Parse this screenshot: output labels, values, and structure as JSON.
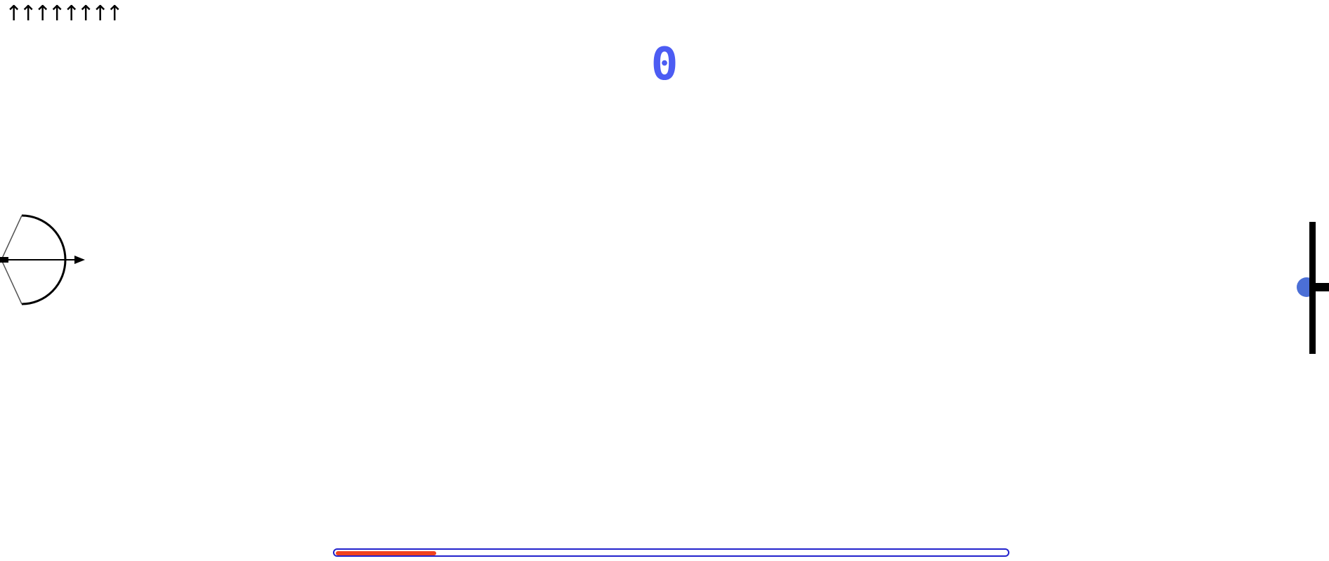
{
  "hud": {
    "arrows_remaining": 8,
    "arrow_glyph": "↑",
    "score": "0",
    "score_color": "#4c5cf3"
  },
  "power_meter": {
    "level": 0.15,
    "fill_color": "#f0421e",
    "border_color": "#2222cc"
  },
  "icons": {
    "bow": "bow-icon",
    "arrow": "arrow-icon",
    "target": "target-icon"
  }
}
